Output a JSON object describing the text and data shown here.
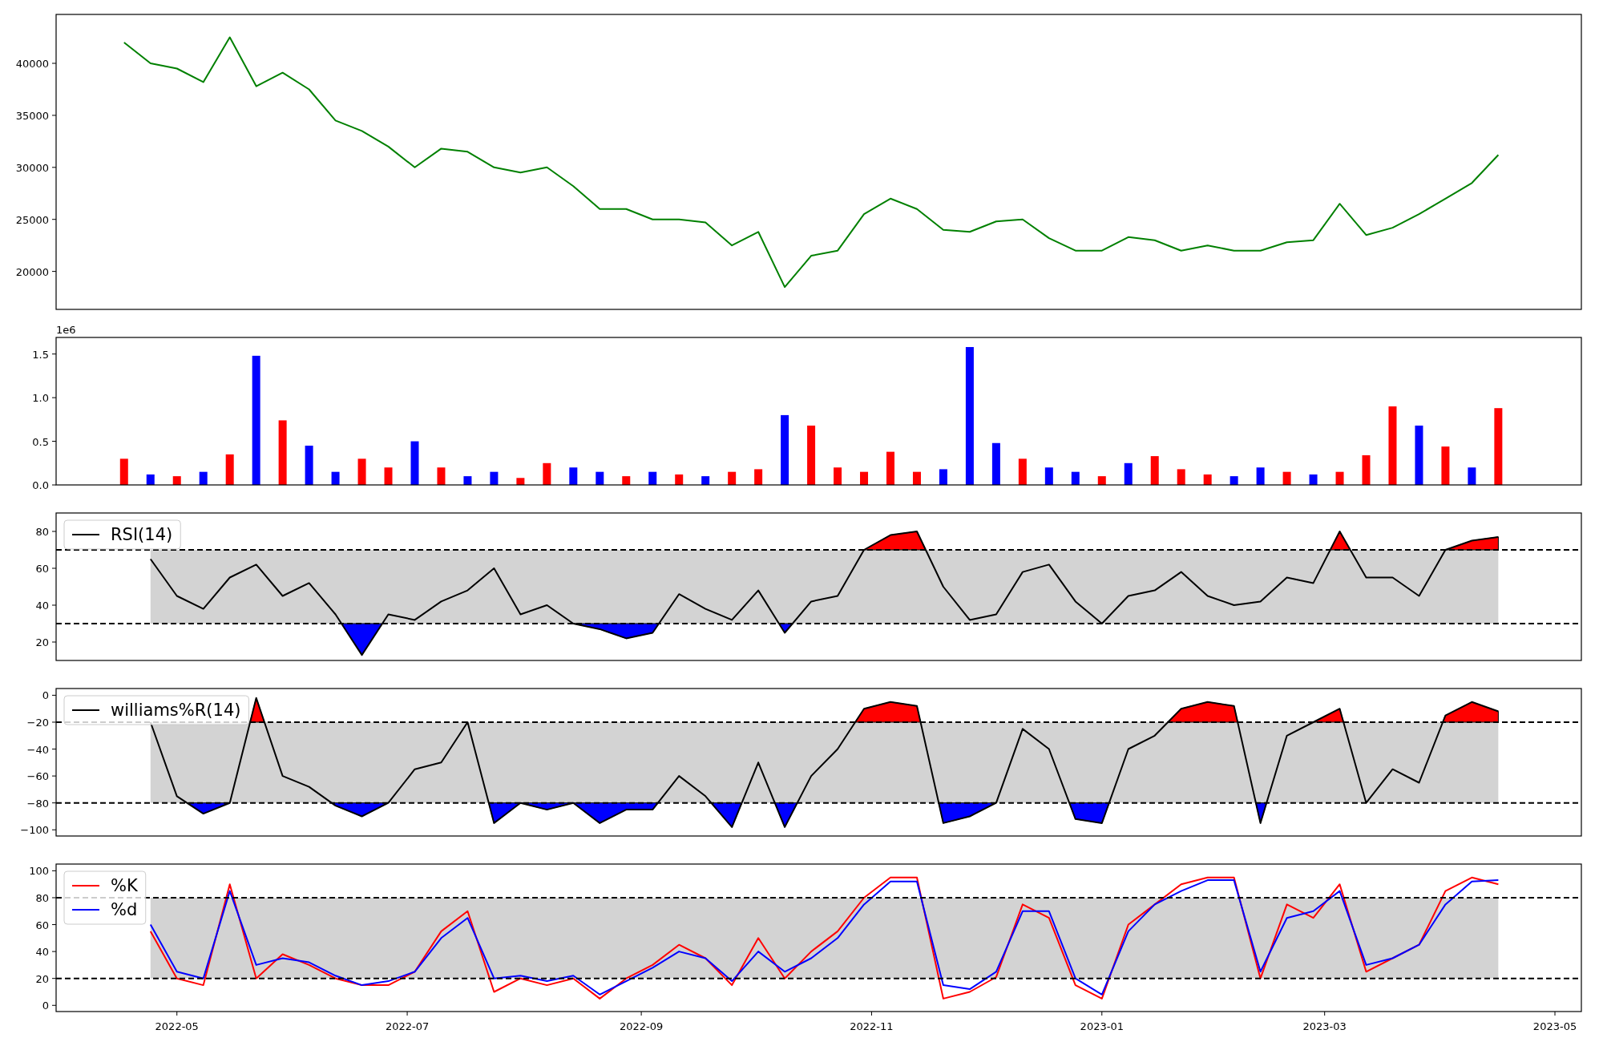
{
  "figure": {
    "panels": [
      {
        "chart_data": {
          "type": "line",
          "xlim": [
            "2022-03-30",
            "2023-05-08"
          ],
          "ylim": [
            16350,
            44700
          ],
          "yticks": [
            20000,
            25000,
            30000,
            35000,
            40000
          ],
          "x": [
            "2022-04-17",
            "2022-04-24",
            "2022-05-01",
            "2022-05-08",
            "2022-05-15",
            "2022-05-22",
            "2022-05-29",
            "2022-06-05",
            "2022-06-12",
            "2022-06-19",
            "2022-06-26",
            "2022-07-03",
            "2022-07-10",
            "2022-07-17",
            "2022-07-24",
            "2022-07-31",
            "2022-08-07",
            "2022-08-14",
            "2022-08-21",
            "2022-08-28",
            "2022-09-04",
            "2022-09-11",
            "2022-09-18",
            "2022-09-25",
            "2022-10-02",
            "2022-10-09",
            "2022-10-16",
            "2022-10-23",
            "2022-10-30",
            "2022-11-06",
            "2022-11-13",
            "2022-11-20",
            "2022-11-27",
            "2022-12-04",
            "2022-12-11",
            "2022-12-18",
            "2022-12-25",
            "2023-01-01",
            "2023-01-08",
            "2023-01-15",
            "2023-01-22",
            "2023-01-29",
            "2023-02-05",
            "2023-02-12",
            "2023-02-19",
            "2023-02-26",
            "2023-03-05",
            "2023-03-12",
            "2023-03-19",
            "2023-03-26",
            "2023-04-02",
            "2023-04-09",
            "2023-04-16"
          ],
          "series": [
            {
              "color": "#008000",
              "values": [
                42000,
                40000,
                39500,
                38200,
                42500,
                37800,
                39100,
                37500,
                34500,
                33500,
                32000,
                30000,
                31800,
                31500,
                30000,
                29500,
                30000,
                28200,
                26000,
                26000,
                25000,
                25000,
                24700,
                22500,
                23800,
                18500,
                21500,
                22000,
                25500,
                27000,
                26000,
                24000,
                23800,
                24800,
                25000,
                23200,
                22000,
                22000,
                23300,
                23000,
                22000,
                22500,
                22000,
                22000,
                22800,
                23000,
                26500,
                23500,
                24200,
                25500,
                27000,
                28500,
                31200
              ]
            }
          ]
        }
      },
      {
        "chart_data": {
          "type": "bar",
          "xlim": [
            "2022-03-30",
            "2023-05-08"
          ],
          "ylim": [
            0,
            1.69
          ],
          "yticks": [
            {
              "value": 0,
              "label": "0.0"
            },
            {
              "value": 0.5,
              "label": "0.5"
            },
            {
              "value": 1,
              "label": "1.0"
            },
            {
              "value": 1.5,
              "label": "1.5"
            }
          ],
          "annotations": [
            {
              "text": "1e6"
            }
          ],
          "x": [
            "2022-04-17",
            "2022-04-24",
            "2022-05-01",
            "2022-05-08",
            "2022-05-15",
            "2022-05-22",
            "2022-05-29",
            "2022-06-05",
            "2022-06-12",
            "2022-06-19",
            "2022-06-26",
            "2022-07-03",
            "2022-07-10",
            "2022-07-17",
            "2022-07-24",
            "2022-07-31",
            "2022-08-07",
            "2022-08-14",
            "2022-08-21",
            "2022-08-28",
            "2022-09-04",
            "2022-09-11",
            "2022-09-18",
            "2022-09-25",
            "2022-10-02",
            "2022-10-09",
            "2022-10-16",
            "2022-10-23",
            "2022-10-30",
            "2022-11-06",
            "2022-11-13",
            "2022-11-20",
            "2022-11-27",
            "2022-12-04",
            "2022-12-11",
            "2022-12-18",
            "2022-12-25",
            "2023-01-01",
            "2023-01-08",
            "2023-01-15",
            "2023-01-22",
            "2023-01-29",
            "2023-02-05",
            "2023-02-12",
            "2023-02-19",
            "2023-02-26",
            "2023-03-05",
            "2023-03-12",
            "2023-03-19",
            "2023-03-26",
            "2023-04-02",
            "2023-04-09",
            "2023-04-16"
          ],
          "series": [
            {
              "color": "#ff0000",
              "values": [
                0.3,
                null,
                0.1,
                null,
                0.35,
                null,
                0.74,
                null,
                null,
                0.3,
                0.2,
                null,
                0.2,
                null,
                null,
                0.08,
                0.25,
                null,
                null,
                0.1,
                null,
                0.12,
                null,
                0.15,
                0.18,
                null,
                0.68,
                0.2,
                0.15,
                0.38,
                0.15,
                null,
                null,
                null,
                0.3,
                null,
                null,
                0.1,
                null,
                0.33,
                0.18,
                0.12,
                null,
                null,
                0.15,
                null,
                0.15,
                0.34,
                0.9,
                null,
                0.44,
                null,
                0.88
              ]
            },
            {
              "color": "#0000ff",
              "values": [
                null,
                0.12,
                null,
                0.15,
                null,
                1.48,
                null,
                0.45,
                0.15,
                null,
                null,
                0.5,
                null,
                0.1,
                0.15,
                null,
                null,
                0.2,
                0.15,
                null,
                0.15,
                null,
                0.1,
                null,
                null,
                0.8,
                null,
                null,
                null,
                null,
                null,
                0.18,
                1.58,
                0.48,
                null,
                0.2,
                0.15,
                null,
                0.25,
                null,
                null,
                null,
                0.1,
                0.2,
                null,
                0.12,
                null,
                null,
                null,
                0.68,
                null,
                0.2,
                null
              ]
            }
          ]
        }
      },
      {
        "fill_extremes": true,
        "chart_data": {
          "type": "line",
          "xlim": [
            "2022-03-30",
            "2023-05-08"
          ],
          "ylim": [
            10,
            90
          ],
          "yticks": [
            20,
            40,
            60,
            80
          ],
          "legend": true,
          "ref_lines": [
            {
              "axis": "y",
              "value": 70
            },
            {
              "axis": "y",
              "value": 30
            }
          ],
          "bands": [
            {
              "axis": "y",
              "from": 30,
              "to": 70
            }
          ],
          "x": [
            "2022-04-24",
            "2022-05-01",
            "2022-05-08",
            "2022-05-15",
            "2022-05-22",
            "2022-05-29",
            "2022-06-05",
            "2022-06-12",
            "2022-06-19",
            "2022-06-26",
            "2022-07-03",
            "2022-07-10",
            "2022-07-17",
            "2022-07-24",
            "2022-07-31",
            "2022-08-07",
            "2022-08-14",
            "2022-08-21",
            "2022-08-28",
            "2022-09-04",
            "2022-09-11",
            "2022-09-18",
            "2022-09-25",
            "2022-10-02",
            "2022-10-09",
            "2022-10-16",
            "2022-10-23",
            "2022-10-30",
            "2022-11-06",
            "2022-11-13",
            "2022-11-20",
            "2022-11-27",
            "2022-12-04",
            "2022-12-11",
            "2022-12-18",
            "2022-12-25",
            "2023-01-01",
            "2023-01-08",
            "2023-01-15",
            "2023-01-22",
            "2023-01-29",
            "2023-02-05",
            "2023-02-12",
            "2023-02-19",
            "2023-02-26",
            "2023-03-05",
            "2023-03-12",
            "2023-03-19",
            "2023-03-26",
            "2023-04-02",
            "2023-04-09",
            "2023-04-16"
          ],
          "series": [
            {
              "name": "RSI(14)",
              "color": "#000000",
              "values": [
                65,
                45,
                38,
                55,
                62,
                45,
                52,
                35,
                13,
                35,
                32,
                42,
                48,
                60,
                35,
                40,
                30,
                27,
                22,
                25,
                46,
                38,
                32,
                48,
                25,
                42,
                45,
                70,
                78,
                80,
                50,
                32,
                35,
                58,
                62,
                42,
                30,
                45,
                48,
                58,
                45,
                40,
                42,
                55,
                52,
                80,
                55,
                55,
                45,
                70,
                75,
                77
              ]
            }
          ]
        }
      },
      {
        "fill_extremes": true,
        "chart_data": {
          "type": "line",
          "xlim": [
            "2022-03-30",
            "2023-05-08"
          ],
          "ylim": [
            -104.6,
            5
          ],
          "yticks": [
            {
              "value": -100,
              "label": "−100"
            },
            {
              "value": -80,
              "label": "−80"
            },
            {
              "value": -60,
              "label": "−60"
            },
            {
              "value": -40,
              "label": "−40"
            },
            {
              "value": -20,
              "label": "−20"
            },
            {
              "value": 0,
              "label": "0"
            }
          ],
          "legend": true,
          "ref_lines": [
            {
              "axis": "y",
              "value": -20
            },
            {
              "axis": "y",
              "value": -80
            }
          ],
          "bands": [
            {
              "axis": "y",
              "from": -80,
              "to": -20
            }
          ],
          "x": [
            "2022-04-24",
            "2022-05-01",
            "2022-05-08",
            "2022-05-15",
            "2022-05-22",
            "2022-05-29",
            "2022-06-05",
            "2022-06-12",
            "2022-06-19",
            "2022-06-26",
            "2022-07-03",
            "2022-07-10",
            "2022-07-17",
            "2022-07-24",
            "2022-07-31",
            "2022-08-07",
            "2022-08-14",
            "2022-08-21",
            "2022-08-28",
            "2022-09-04",
            "2022-09-11",
            "2022-09-18",
            "2022-09-25",
            "2022-10-02",
            "2022-10-09",
            "2022-10-16",
            "2022-10-23",
            "2022-10-30",
            "2022-11-06",
            "2022-11-13",
            "2022-11-20",
            "2022-11-27",
            "2022-12-04",
            "2022-12-11",
            "2022-12-18",
            "2022-12-25",
            "2023-01-01",
            "2023-01-08",
            "2023-01-15",
            "2023-01-22",
            "2023-01-29",
            "2023-02-05",
            "2023-02-12",
            "2023-02-19",
            "2023-02-26",
            "2023-03-05",
            "2023-03-12",
            "2023-03-19",
            "2023-03-26",
            "2023-04-02",
            "2023-04-09",
            "2023-04-16"
          ],
          "series": [
            {
              "name": "williams%R(14)",
              "color": "#000000",
              "values": [
                -20,
                -75,
                -88,
                -80,
                -2,
                -60,
                -68,
                -82,
                -90,
                -80,
                -55,
                -50,
                -20,
                -95,
                -80,
                -85,
                -80,
                -95,
                -85,
                -85,
                -60,
                -75,
                -98,
                -50,
                -98,
                -60,
                -40,
                -10,
                -5,
                -8,
                -95,
                -90,
                -80,
                -25,
                -40,
                -92,
                -95,
                -40,
                -30,
                -10,
                -5,
                -8,
                -95,
                -30,
                -20,
                -10,
                -80,
                -55,
                -65,
                -15,
                -5,
                -12
              ]
            }
          ]
        }
      },
      {
        "fill_extremes": false,
        "chart_data": {
          "type": "line",
          "xlim": [
            "2022-03-30",
            "2023-05-08"
          ],
          "ylim": [
            -4.6,
            105
          ],
          "yticks": [
            0,
            20,
            40,
            60,
            80,
            100
          ],
          "legend": true,
          "ref_lines": [
            {
              "axis": "y",
              "value": 80
            },
            {
              "axis": "y",
              "value": 20
            }
          ],
          "bands": [
            {
              "axis": "y",
              "from": 20,
              "to": 80
            }
          ],
          "xticks": [
            {
              "value": "2022-05-01",
              "label": "2022-05"
            },
            {
              "value": "2022-07-01",
              "label": "2022-07"
            },
            {
              "value": "2022-09-01",
              "label": "2022-09"
            },
            {
              "value": "2022-11-01",
              "label": "2022-11"
            },
            {
              "value": "2023-01-01",
              "label": "2023-01"
            },
            {
              "value": "2023-03-01",
              "label": "2023-03"
            },
            {
              "value": "2023-05-01",
              "label": "2023-05"
            }
          ],
          "x": [
            "2022-04-24",
            "2022-05-01",
            "2022-05-08",
            "2022-05-15",
            "2022-05-22",
            "2022-05-29",
            "2022-06-05",
            "2022-06-12",
            "2022-06-19",
            "2022-06-26",
            "2022-07-03",
            "2022-07-10",
            "2022-07-17",
            "2022-07-24",
            "2022-07-31",
            "2022-08-07",
            "2022-08-14",
            "2022-08-21",
            "2022-08-28",
            "2022-09-04",
            "2022-09-11",
            "2022-09-18",
            "2022-09-25",
            "2022-10-02",
            "2022-10-09",
            "2022-10-16",
            "2022-10-23",
            "2022-10-30",
            "2022-11-06",
            "2022-11-13",
            "2022-11-20",
            "2022-11-27",
            "2022-12-04",
            "2022-12-11",
            "2022-12-18",
            "2022-12-25",
            "2023-01-01",
            "2023-01-08",
            "2023-01-15",
            "2023-01-22",
            "2023-01-29",
            "2023-02-05",
            "2023-02-12",
            "2023-02-19",
            "2023-02-26",
            "2023-03-05",
            "2023-03-12",
            "2023-03-19",
            "2023-03-26",
            "2023-04-02",
            "2023-04-09",
            "2023-04-16"
          ],
          "series": [
            {
              "name": "%K",
              "color": "#ff0000",
              "values": [
                55,
                20,
                15,
                90,
                20,
                38,
                30,
                20,
                15,
                15,
                25,
                55,
                70,
                10,
                20,
                15,
                20,
                5,
                20,
                30,
                45,
                35,
                15,
                50,
                20,
                40,
                55,
                80,
                95,
                95,
                5,
                10,
                21,
                75,
                65,
                15,
                5,
                60,
                75,
                90,
                95,
                95,
                20,
                75,
                65,
                90,
                25,
                35,
                45,
                85,
                95,
                90
              ]
            },
            {
              "name": "%d",
              "color": "#0000ff",
              "values": [
                60,
                25,
                20,
                85,
                30,
                35,
                32,
                22,
                15,
                18,
                25,
                50,
                65,
                20,
                22,
                18,
                22,
                8,
                18,
                28,
                40,
                35,
                18,
                40,
                25,
                35,
                50,
                75,
                92,
                92,
                15,
                12,
                25,
                70,
                70,
                20,
                8,
                55,
                75,
                85,
                93,
                93,
                25,
                65,
                70,
                85,
                30,
                35,
                45,
                75,
                92,
                93
              ]
            }
          ]
        }
      }
    ]
  }
}
